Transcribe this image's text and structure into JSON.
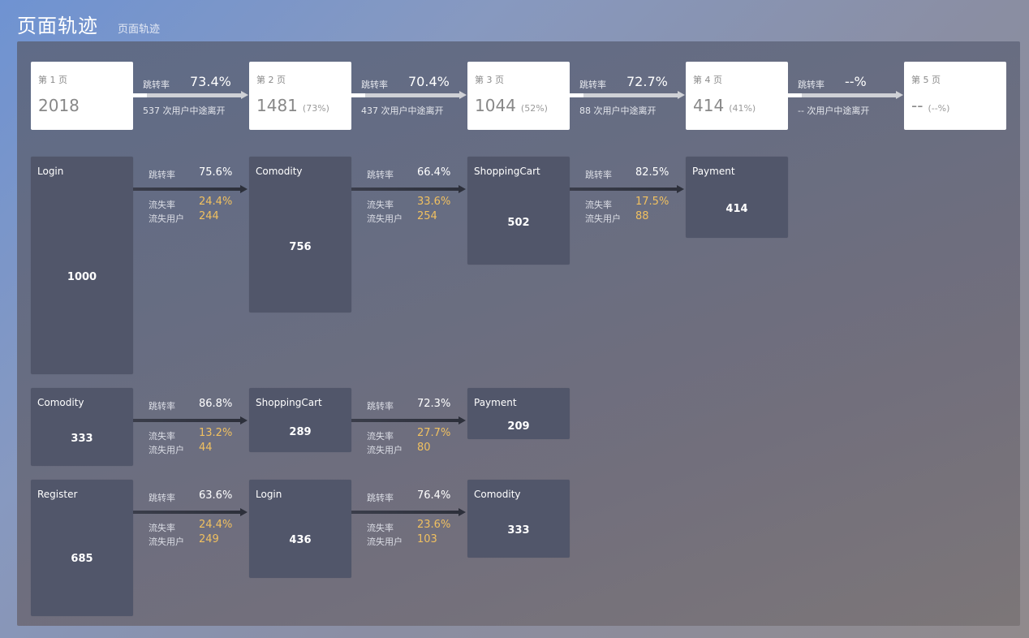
{
  "header": {
    "title": "页面轨迹",
    "subtitle": "页面轨迹"
  },
  "summary": {
    "cards": [
      {
        "title": "第 1 页",
        "value": "2018",
        "pct": ""
      },
      {
        "title": "第 2 页",
        "value": "1481",
        "pct": "(73%)"
      },
      {
        "title": "第 3 页",
        "value": "1044",
        "pct": "(52%)"
      },
      {
        "title": "第 4 页",
        "value": "414",
        "pct": "(41%)"
      },
      {
        "title": "第 5 页",
        "value": "--",
        "pct": "(--%)"
      }
    ],
    "connectors": [
      {
        "rate_label": "跳转率",
        "rate": "73.4%",
        "leave": "537 次用户中途离开"
      },
      {
        "rate_label": "跳转率",
        "rate": "70.4%",
        "leave": "437 次用户中途离开"
      },
      {
        "rate_label": "跳转率",
        "rate": "72.7%",
        "leave": "88 次用户中途离开"
      },
      {
        "rate_label": "跳转率",
        "rate": "--%",
        "leave": "-- 次用户中途离开"
      }
    ]
  },
  "tracks": [
    {
      "nodes": [
        {
          "name": "Login",
          "value": "1000"
        },
        {
          "name": "Comodity",
          "value": "756"
        },
        {
          "name": "ShoppingCart",
          "value": "502"
        },
        {
          "name": "Payment",
          "value": "414"
        }
      ],
      "connectors": [
        {
          "rate_label": "跳转率",
          "rate": "75.6%",
          "loss_label": "流失率",
          "loss": "24.4%",
          "lost_label": "流失用户",
          "lost": "244"
        },
        {
          "rate_label": "跳转率",
          "rate": "66.4%",
          "loss_label": "流失率",
          "loss": "33.6%",
          "lost_label": "流失用户",
          "lost": "254"
        },
        {
          "rate_label": "跳转率",
          "rate": "82.5%",
          "loss_label": "流失率",
          "loss": "17.5%",
          "lost_label": "流失用户",
          "lost": "88"
        }
      ]
    },
    {
      "nodes": [
        {
          "name": "Comodity",
          "value": "333"
        },
        {
          "name": "ShoppingCart",
          "value": "289"
        },
        {
          "name": "Payment",
          "value": "209"
        }
      ],
      "connectors": [
        {
          "rate_label": "跳转率",
          "rate": "86.8%",
          "loss_label": "流失率",
          "loss": "13.2%",
          "lost_label": "流失用户",
          "lost": "44"
        },
        {
          "rate_label": "跳转率",
          "rate": "72.3%",
          "loss_label": "流失率",
          "loss": "27.7%",
          "lost_label": "流失用户",
          "lost": "80"
        }
      ]
    },
    {
      "nodes": [
        {
          "name": "Register",
          "value": "685"
        },
        {
          "name": "Login",
          "value": "436"
        },
        {
          "name": "Comodity",
          "value": "333"
        }
      ],
      "connectors": [
        {
          "rate_label": "跳转率",
          "rate": "63.6%",
          "loss_label": "流失率",
          "loss": "24.4%",
          "lost_label": "流失用户",
          "lost": "249"
        },
        {
          "rate_label": "跳转率",
          "rate": "76.4%",
          "loss_label": "流失率",
          "loss": "23.6%",
          "lost_label": "流失用户",
          "lost": "103"
        }
      ]
    }
  ]
}
